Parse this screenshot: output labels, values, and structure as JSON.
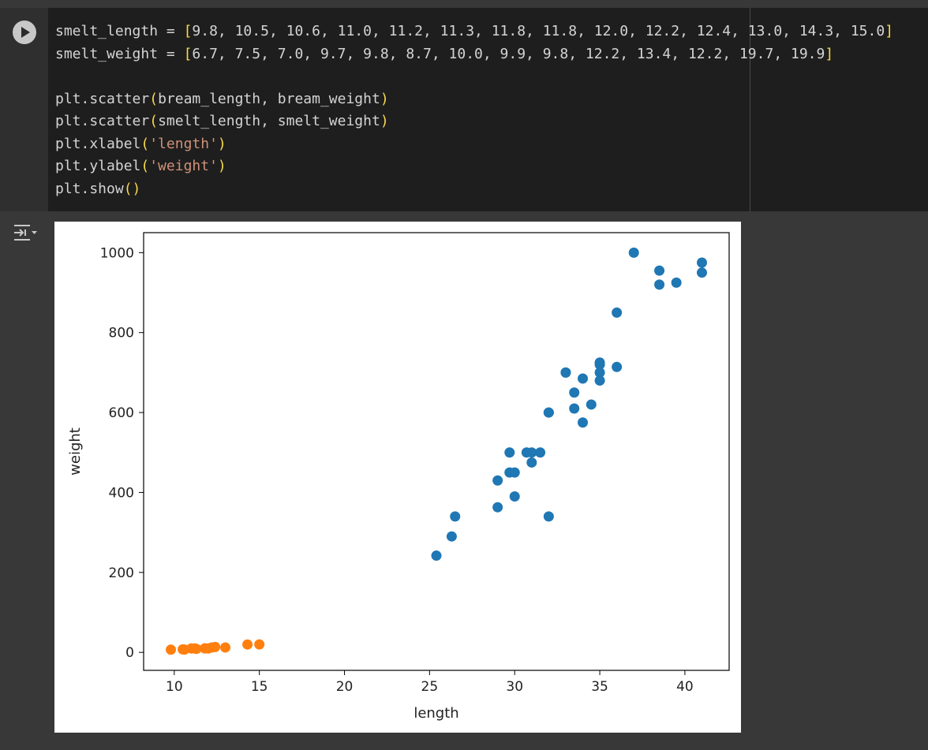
{
  "code": {
    "lines": [
      {
        "parts": [
          {
            "t": "smelt_length = "
          },
          {
            "t": "[",
            "c": "br"
          },
          {
            "t": "9.8, 10.5, 10.6, 11.0, 11.2, 11.3, 11.8, 11.8, 12.0, 12.2, 12.4, 13.0, 14.3, 15.0"
          },
          {
            "t": "]",
            "c": "br"
          }
        ]
      },
      {
        "parts": [
          {
            "t": "smelt_weight = "
          },
          {
            "t": "[",
            "c": "br"
          },
          {
            "t": "6.7, 7.5, 7.0, 9.7, 9.8, 8.7, 10.0, 9.9, 9.8, 12.2, 13.4, 12.2, 19.7, 19.9"
          },
          {
            "t": "]",
            "c": "br"
          }
        ]
      },
      {
        "parts": []
      },
      {
        "parts": [
          {
            "t": "plt.scatter"
          },
          {
            "t": "(",
            "c": "br"
          },
          {
            "t": "bream_length, bream_weight"
          },
          {
            "t": ")",
            "c": "br"
          }
        ]
      },
      {
        "parts": [
          {
            "t": "plt.scatter"
          },
          {
            "t": "(",
            "c": "br"
          },
          {
            "t": "smelt_length, smelt_weight"
          },
          {
            "t": ")",
            "c": "br"
          }
        ]
      },
      {
        "parts": [
          {
            "t": "plt.xlabel"
          },
          {
            "t": "(",
            "c": "br"
          },
          {
            "t": "'length'",
            "c": "str"
          },
          {
            "t": ")",
            "c": "br"
          }
        ]
      },
      {
        "parts": [
          {
            "t": "plt.ylabel"
          },
          {
            "t": "(",
            "c": "br"
          },
          {
            "t": "'weight'",
            "c": "str"
          },
          {
            "t": ")",
            "c": "br"
          }
        ]
      },
      {
        "parts": [
          {
            "t": "plt.show"
          },
          {
            "t": "()",
            "c": "br"
          }
        ]
      }
    ]
  },
  "chart_data": {
    "type": "scatter",
    "title": "",
    "xlabel": "length",
    "ylabel": "weight",
    "xlim": [
      8.2,
      42.6
    ],
    "ylim": [
      -45,
      1050
    ],
    "xticks": [
      10,
      15,
      20,
      25,
      30,
      35,
      40
    ],
    "yticks": [
      0,
      200,
      400,
      600,
      800,
      1000
    ],
    "grid": false,
    "series": [
      {
        "color": "#1f77b4",
        "x": [
          25.4,
          26.3,
          26.5,
          29.0,
          29.0,
          29.7,
          29.7,
          30.0,
          30.0,
          30.7,
          31.0,
          31.0,
          31.5,
          32.0,
          32.0,
          32.0,
          33.0,
          33.0,
          33.5,
          33.5,
          34.0,
          34.0,
          34.5,
          35.0,
          35.0,
          35.0,
          35.0,
          36.0,
          36.0,
          37.0,
          38.5,
          38.5,
          39.5,
          41.0,
          41.0
        ],
        "y": [
          242,
          290,
          340,
          363,
          430,
          450,
          500,
          390,
          450,
          500,
          475,
          500,
          500,
          340,
          600,
          600,
          700,
          700,
          610,
          650,
          575,
          685,
          620,
          680,
          700,
          725,
          720,
          714,
          850,
          1000,
          920,
          955,
          925,
          975,
          950
        ]
      },
      {
        "color": "#ff7f0e",
        "x": [
          9.8,
          10.5,
          10.6,
          11.0,
          11.2,
          11.3,
          11.8,
          11.8,
          12.0,
          12.2,
          12.4,
          13.0,
          14.3,
          15.0
        ],
        "y": [
          6.7,
          7.5,
          7.0,
          9.7,
          9.8,
          8.7,
          10.0,
          9.9,
          9.8,
          12.2,
          13.4,
          12.2,
          19.7,
          19.9
        ]
      }
    ]
  }
}
